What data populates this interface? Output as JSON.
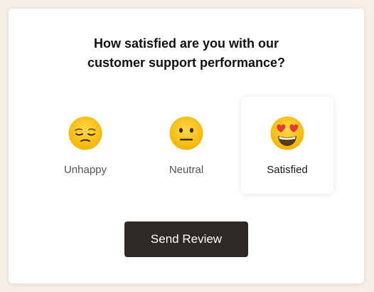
{
  "survey": {
    "question_line1": "How satisfied are you with our",
    "question_line2": "customer support performance?",
    "options": [
      {
        "label": "Unhappy",
        "icon": "pensive-face-icon",
        "selected": false
      },
      {
        "label": "Neutral",
        "icon": "neutral-face-icon",
        "selected": false
      },
      {
        "label": "Satisfied",
        "icon": "heart-eyes-face-icon",
        "selected": true
      }
    ],
    "submit_label": "Send Review"
  },
  "colors": {
    "page_background": "#f5efe6",
    "card_background": "#ffffff",
    "button_background": "#2d2926",
    "button_text": "#ffffff",
    "emoji_yellow": "#fcc21b"
  }
}
